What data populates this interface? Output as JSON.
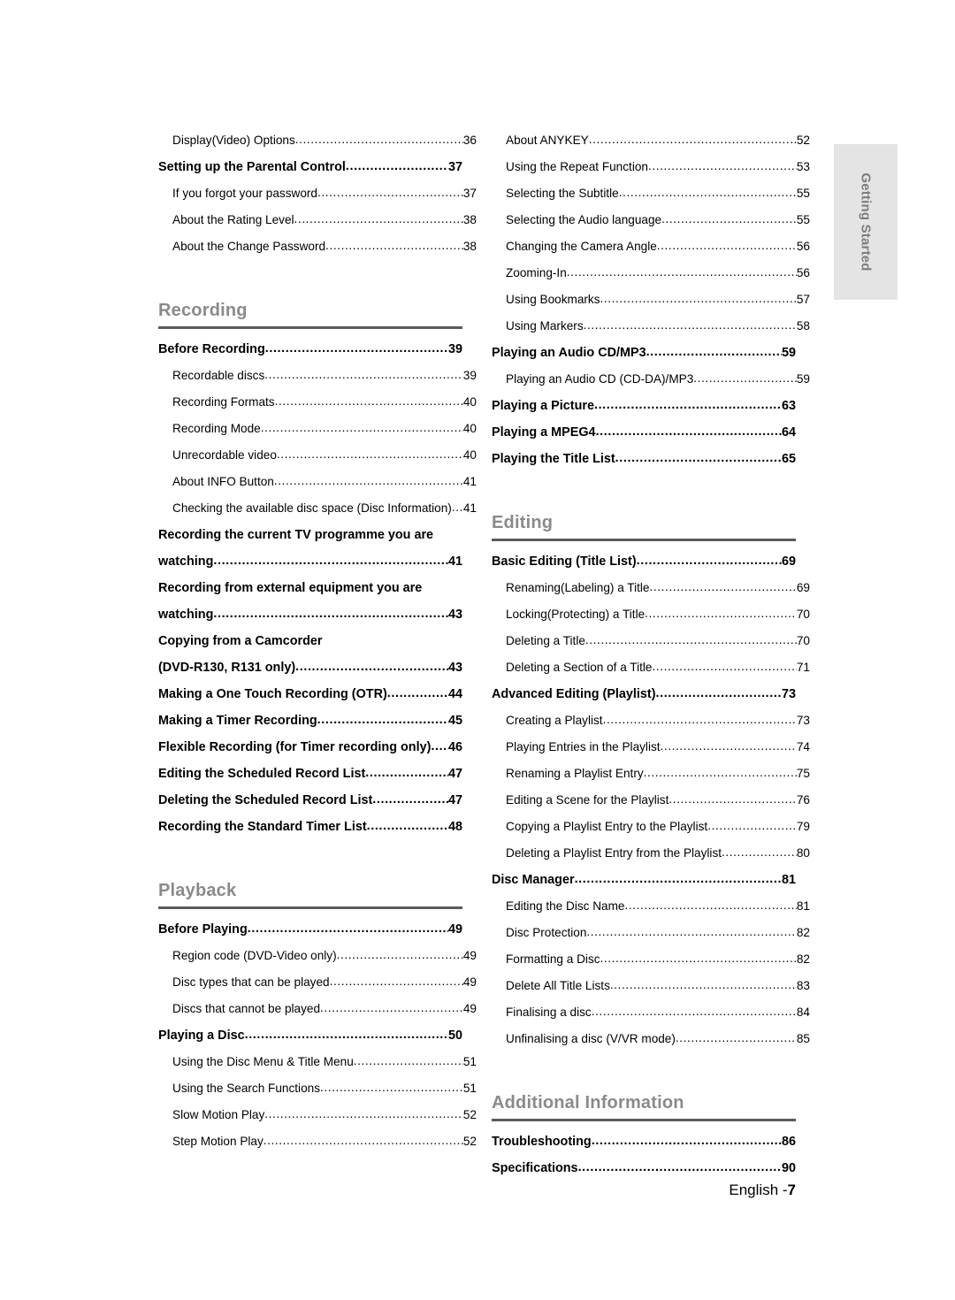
{
  "side_tab": {
    "label": "Getting Started"
  },
  "footer": {
    "language": "English -",
    "page": "7"
  },
  "columns": [
    {
      "name": "left",
      "blocks": [
        {
          "type": "entries",
          "entries": [
            {
              "level": 2,
              "label": "Display(Video) Options",
              "page": "36"
            },
            {
              "level": 1,
              "label": "Setting up the Parental Control",
              "page": "37"
            },
            {
              "level": 2,
              "label": "If you forgot your password",
              "page": "37"
            },
            {
              "level": 2,
              "label": "About the Rating Level",
              "page": "38"
            },
            {
              "level": 2,
              "label": "About the Change Password",
              "page": "38"
            }
          ]
        },
        {
          "type": "section",
          "title": "Recording",
          "entries": [
            {
              "level": 1,
              "label": "Before Recording",
              "page": "39"
            },
            {
              "level": 2,
              "label": "Recordable discs",
              "page": "39"
            },
            {
              "level": 2,
              "label": "Recording Formats",
              "page": "40"
            },
            {
              "level": 2,
              "label": "Recording Mode",
              "page": "40"
            },
            {
              "level": 2,
              "label": "Unrecordable video",
              "page": "40"
            },
            {
              "level": 2,
              "label": "About INFO Button",
              "page": "41"
            },
            {
              "level": 2,
              "label": "Checking the available disc space (Disc Information)",
              "page": "41",
              "tight": true
            },
            {
              "level": 1,
              "label": "Recording the current TV programme you are",
              "page": "",
              "noleader": true
            },
            {
              "level": 1,
              "label": "watching",
              "page": "41"
            },
            {
              "level": 1,
              "label": "Recording from external equipment you are",
              "page": "",
              "noleader": true
            },
            {
              "level": 1,
              "label": "watching",
              "page": "43"
            },
            {
              "level": 1,
              "label": "Copying from a Camcorder",
              "page": "",
              "noleader": true
            },
            {
              "level": 1,
              "label": "(DVD-R130, R131 only)",
              "page": "43"
            },
            {
              "level": 1,
              "label": "Making a One Touch Recording (OTR)",
              "page": "44"
            },
            {
              "level": 1,
              "label": "Making a Timer Recording",
              "page": "45"
            },
            {
              "level": 1,
              "label": "Flexible Recording (for Timer recording only)",
              "page": "46"
            },
            {
              "level": 1,
              "label": "Editing the Scheduled Record List",
              "page": "47"
            },
            {
              "level": 1,
              "label": "Deleting the Scheduled Record List",
              "page": "47"
            },
            {
              "level": 1,
              "label": "Recording the Standard Timer List",
              "page": "48"
            }
          ]
        },
        {
          "type": "section",
          "title": "Playback",
          "entries": [
            {
              "level": 1,
              "label": "Before Playing",
              "page": "49"
            },
            {
              "level": 2,
              "label": "Region code (DVD-Video only)",
              "page": "49"
            },
            {
              "level": 2,
              "label": "Disc types that can be played",
              "page": "49"
            },
            {
              "level": 2,
              "label": "Discs that cannot be played",
              "page": "49"
            },
            {
              "level": 1,
              "label": "Playing a Disc",
              "page": "50"
            },
            {
              "level": 2,
              "label": "Using the Disc Menu & Title Menu",
              "page": "51"
            },
            {
              "level": 2,
              "label": "Using the Search Functions",
              "page": "51"
            },
            {
              "level": 2,
              "label": "Slow Motion Play",
              "page": "52"
            },
            {
              "level": 2,
              "label": "Step Motion Play",
              "page": "52"
            }
          ]
        }
      ]
    },
    {
      "name": "right",
      "blocks": [
        {
          "type": "entries",
          "entries": [
            {
              "level": 2,
              "label": "About ANYKEY",
              "page": "52"
            },
            {
              "level": 2,
              "label": "Using the Repeat Function",
              "page": "53"
            },
            {
              "level": 2,
              "label": "Selecting the Subtitle",
              "page": "55"
            },
            {
              "level": 2,
              "label": "Selecting the Audio language",
              "page": "55"
            },
            {
              "level": 2,
              "label": "Changing the Camera Angle",
              "page": "56"
            },
            {
              "level": 2,
              "label": "Zooming-In",
              "page": "56"
            },
            {
              "level": 2,
              "label": "Using Bookmarks",
              "page": "57"
            },
            {
              "level": 2,
              "label": "Using Markers",
              "page": "58"
            },
            {
              "level": 1,
              "label": "Playing an Audio CD/MP3",
              "page": "59"
            },
            {
              "level": 2,
              "label": "Playing an Audio CD (CD-DA)/MP3",
              "page": "59"
            },
            {
              "level": 1,
              "label": "Playing a Picture",
              "page": "63"
            },
            {
              "level": 1,
              "label": "Playing a MPEG4",
              "page": "64"
            },
            {
              "level": 1,
              "label": "Playing the Title List",
              "page": "65"
            }
          ]
        },
        {
          "type": "section",
          "title": "Editing",
          "entries": [
            {
              "level": 1,
              "label": "Basic Editing (Title List)",
              "page": "69"
            },
            {
              "level": 2,
              "label": "Renaming(Labeling) a Title",
              "page": "69"
            },
            {
              "level": 2,
              "label": "Locking(Protecting) a Title",
              "page": "70"
            },
            {
              "level": 2,
              "label": "Deleting a Title",
              "page": "70"
            },
            {
              "level": 2,
              "label": "Deleting a Section of a Title",
              "page": "71"
            },
            {
              "level": 1,
              "label": "Advanced Editing (Playlist)",
              "page": "73"
            },
            {
              "level": 2,
              "label": "Creating a Playlist",
              "page": "73"
            },
            {
              "level": 2,
              "label": "Playing Entries in the Playlist",
              "page": "74"
            },
            {
              "level": 2,
              "label": "Renaming a Playlist Entry",
              "page": "75"
            },
            {
              "level": 2,
              "label": "Editing a Scene for the Playlist",
              "page": "76"
            },
            {
              "level": 2,
              "label": "Copying a Playlist Entry to the Playlist",
              "page": "79"
            },
            {
              "level": 2,
              "label": "Deleting a Playlist Entry from the Playlist",
              "page": "80"
            },
            {
              "level": 1,
              "label": "Disc Manager",
              "page": "81"
            },
            {
              "level": 2,
              "label": "Editing the Disc Name",
              "page": "81"
            },
            {
              "level": 2,
              "label": "Disc Protection",
              "page": "82"
            },
            {
              "level": 2,
              "label": "Formatting a Disc",
              "page": "82"
            },
            {
              "level": 2,
              "label": "Delete All Title Lists",
              "page": "83"
            },
            {
              "level": 2,
              "label": "Finalising a disc",
              "page": "84"
            },
            {
              "level": 2,
              "label": "Unfinalising a disc (V/VR mode)",
              "page": "85"
            }
          ]
        },
        {
          "type": "section",
          "title": "Additional Information",
          "entries": [
            {
              "level": 1,
              "label": "Troubleshooting",
              "page": "86"
            },
            {
              "level": 1,
              "label": "Specifications",
              "page": "90"
            }
          ]
        }
      ]
    }
  ]
}
